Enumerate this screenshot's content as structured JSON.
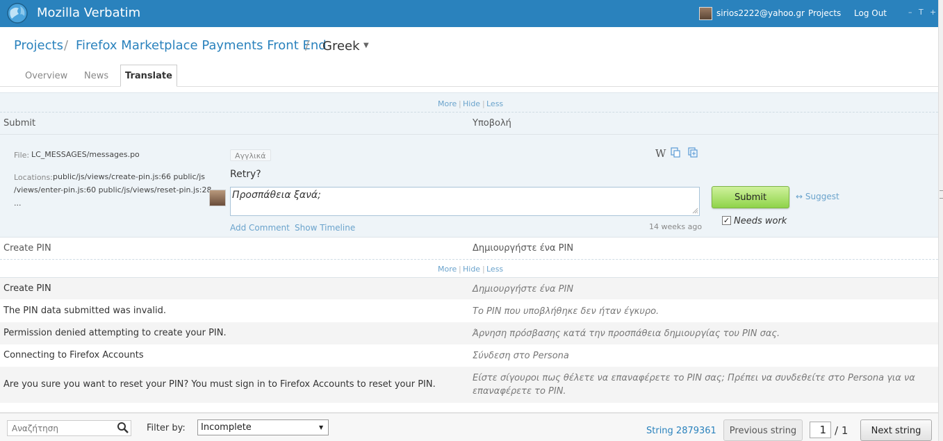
{
  "header": {
    "app_title": "Mozilla Verbatim",
    "user_email": "sirios2222@yahoo.gr",
    "nav_projects": "Projects",
    "nav_logout": "Log Out",
    "window_min": "–",
    "window_t": "T",
    "window_plus": "+"
  },
  "breadcrumb": {
    "root": "Projects",
    "sep1": "/",
    "project": "Firefox Marketplace Payments Front End",
    "sep2": "/",
    "language": "Greek"
  },
  "tabs": [
    {
      "label": "Overview"
    },
    {
      "label": "News"
    },
    {
      "label": "Translate"
    }
  ],
  "more_hide_less": {
    "more": "More",
    "sep": "|",
    "hide": "Hide",
    "less": "Less"
  },
  "active_string": {
    "source_heading": "Submit",
    "target_heading": "Υποβολή",
    "file_label": "File:",
    "file_value": "LC_MESSAGES/messages.po",
    "locations_label": "Locations:",
    "locations_line1": "public/js/views/create-pin.js:66 public/js",
    "locations_line2": "/views/enter-pin.js:60 public/js/views/reset-pin.js:28",
    "locations_line3": "...",
    "lang_tag": "Αγγλικά",
    "wiki_tool": "W",
    "source_text": "Retry?",
    "translation": "Προσπάθεια ξανά;",
    "add_comment": "Add Comment",
    "show_timeline": "Show Timeline",
    "timestamp": "14 weeks ago",
    "submit_label": "Submit",
    "suggest_label": "↔ Suggest",
    "needs_work_label": "Needs work",
    "needs_work_checked": true
  },
  "next_group": {
    "source_heading": "Create PIN",
    "target_heading": "Δημιουργήστε ένα PIN"
  },
  "strings": [
    {
      "source": "Create PIN",
      "target": "Δημιουργήστε ένα PIN"
    },
    {
      "source": "The PIN data submitted was invalid.",
      "target": "Το PIN που υποβλήθηκε δεν ήταν έγκυρο."
    },
    {
      "source": "Permission denied attempting to create your PIN.",
      "target": "Άρνηση πρόσβασης κατά την προσπάθεια δημιουργίας του PIN σας."
    },
    {
      "source": "Connecting to Firefox Accounts",
      "target": "Σύνδεση στο Persona"
    },
    {
      "source": "Are you sure you want to reset your PIN? You must sign in to Firefox Accounts to reset your PIN.",
      "target": "Είστε σίγουροι πως θέλετε να επαναφέρετε το PIN σας; Πρέπει να συνδεθείτε στο Persona για να επαναφέρετε το PIN."
    }
  ],
  "footer": {
    "search_placeholder": "Αναζήτηση",
    "filter_label": "Filter by:",
    "filter_value": "Incomplete",
    "string_id": "String 2879361",
    "prev_label": "Previous string",
    "page_current": "1",
    "page_total": "/ 1",
    "next_label": "Next string"
  },
  "colors": {
    "header_bg": "#2a82bd",
    "link": "#2a82bd",
    "panel_bg": "#eef4f8",
    "submit_green": "#8fd34a"
  }
}
